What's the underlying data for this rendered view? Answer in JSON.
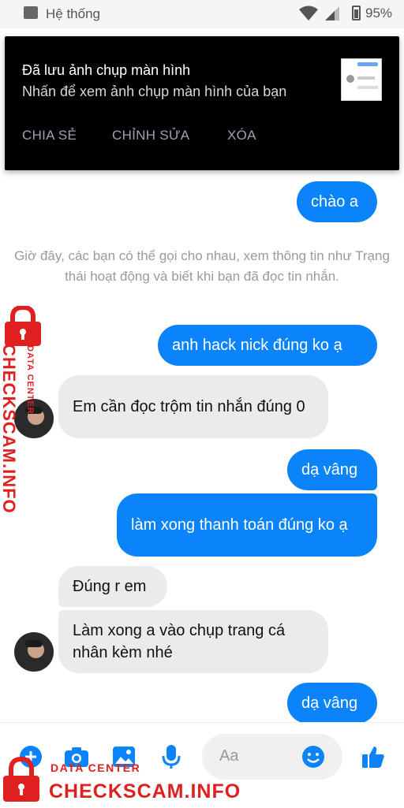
{
  "status_bar": {
    "label": "Hệ thống",
    "battery": "95%"
  },
  "notification": {
    "title": "Đã lưu ảnh chụp màn hình",
    "body": "Nhấn để xem ảnh chụp màn hình của bạn",
    "actions": [
      "CHIA SẺ",
      "CHỈNH SỬA",
      "XÓA"
    ]
  },
  "messages": [
    {
      "side": "out",
      "text": "chào a"
    },
    {
      "side": "system",
      "text": "Giờ đây, các bạn có thể gọi cho nhau, xem thông tin như Trạng thái hoạt động và biết khi bạn đã đọc tin nhắn."
    },
    {
      "side": "out",
      "text": "anh hack nick đúng ko ạ"
    },
    {
      "side": "in",
      "text": "Em cần đọc trộm tin nhắn đúng 0"
    },
    {
      "side": "out",
      "text": "dạ vâng"
    },
    {
      "side": "out",
      "text": "làm xong thanh toán đúng ko ạ"
    },
    {
      "side": "in",
      "text": "Đúng r em"
    },
    {
      "side": "in",
      "text": "Làm xong a vào chụp trang cá nhân kèm nhé"
    },
    {
      "side": "out",
      "text": "dạ vâng"
    }
  ],
  "composer": {
    "placeholder": "Aa"
  },
  "watermark": {
    "small": "DATA CENTER",
    "big": "CHECKSCAM.INFO"
  },
  "colors": {
    "outgoing": "#0b83fb",
    "incoming": "#ebebeb",
    "watermark": "#e02020"
  },
  "icons": [
    "plus-icon",
    "camera-icon",
    "photo-icon",
    "microphone-icon",
    "emoji-icon",
    "thumbs-up-icon",
    "lock-icon",
    "wifi-icon",
    "signal-icon",
    "battery-icon"
  ]
}
